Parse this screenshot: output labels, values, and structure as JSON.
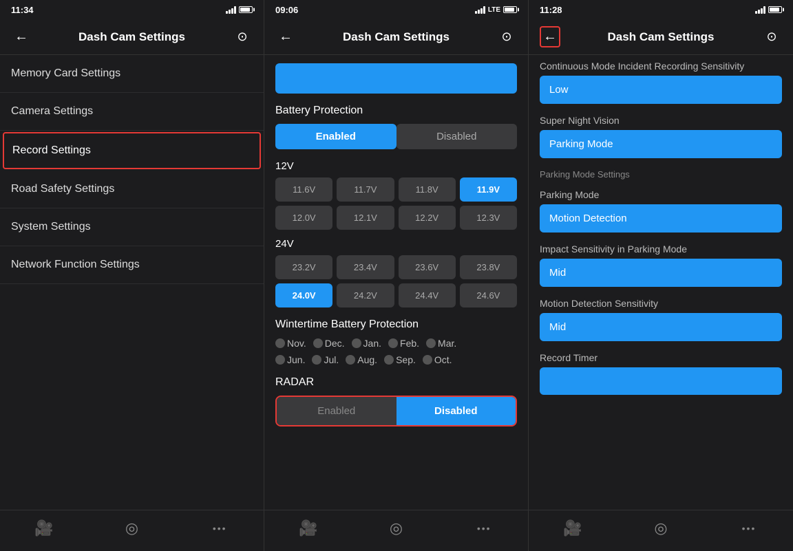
{
  "panels": [
    {
      "id": "left",
      "statusBar": {
        "time": "11:34",
        "signal": true,
        "battery": true
      },
      "header": {
        "backLabel": "←",
        "title": "Dash Cam Settings",
        "iconLabel": "⊙"
      },
      "menuItems": [
        {
          "id": "memory-card",
          "label": "Memory Card Settings",
          "active": false
        },
        {
          "id": "camera",
          "label": "Camera Settings",
          "active": false
        },
        {
          "id": "record",
          "label": "Record Settings",
          "active": true
        },
        {
          "id": "road-safety",
          "label": "Road Safety Settings",
          "active": false
        },
        {
          "id": "system",
          "label": "System Settings",
          "active": false
        },
        {
          "id": "network",
          "label": "Network Function Settings",
          "active": false
        }
      ],
      "tabBar": {
        "items": [
          {
            "id": "camera-tab",
            "icon": "🎥",
            "active": true
          },
          {
            "id": "wifi-tab",
            "icon": "◎",
            "active": false
          },
          {
            "id": "more-tab",
            "icon": "•••",
            "active": false
          }
        ]
      }
    },
    {
      "id": "middle",
      "statusBar": {
        "time": "09:06",
        "signal": true,
        "lte": true,
        "battery": true
      },
      "header": {
        "backLabel": "←",
        "title": "Dash Cam Settings",
        "iconLabel": "⊙"
      },
      "batteryProtection": {
        "label": "Battery Protection",
        "enabledLabel": "Enabled",
        "disabledLabel": "Disabled",
        "selected": "enabled"
      },
      "voltage12": {
        "label": "12V",
        "values": [
          {
            "val": "11.6V",
            "selected": false
          },
          {
            "val": "11.7V",
            "selected": false
          },
          {
            "val": "11.8V",
            "selected": false
          },
          {
            "val": "11.9V",
            "selected": true
          },
          {
            "val": "12.0V",
            "selected": false
          },
          {
            "val": "12.1V",
            "selected": false
          },
          {
            "val": "12.2V",
            "selected": false
          },
          {
            "val": "12.3V",
            "selected": false
          }
        ]
      },
      "voltage24": {
        "label": "24V",
        "values": [
          {
            "val": "23.2V",
            "selected": false
          },
          {
            "val": "23.4V",
            "selected": false
          },
          {
            "val": "23.6V",
            "selected": false
          },
          {
            "val": "23.8V",
            "selected": false
          },
          {
            "val": "24.0V",
            "selected": true
          },
          {
            "val": "24.2V",
            "selected": false
          },
          {
            "val": "24.4V",
            "selected": false
          },
          {
            "val": "24.6V",
            "selected": false
          }
        ]
      },
      "wintertimeBatteryProtection": {
        "label": "Wintertime Battery Protection",
        "months1": [
          "Nov.",
          "Dec.",
          "Jan.",
          "Feb.",
          "Mar."
        ],
        "months2": [
          "Jun.",
          "Jul.",
          "Aug.",
          "Sep.",
          "Oct."
        ]
      },
      "radar": {
        "label": "RADAR",
        "enabledLabel": "Enabled",
        "disabledLabel": "Disabled",
        "selected": "disabled"
      },
      "tabBar": {
        "items": [
          {
            "id": "camera-tab",
            "icon": "🎥",
            "active": true
          },
          {
            "id": "wifi-tab",
            "icon": "◎",
            "active": false
          },
          {
            "id": "more-tab",
            "icon": "•••",
            "active": false
          }
        ]
      }
    },
    {
      "id": "right",
      "statusBar": {
        "time": "11:28",
        "signal": true,
        "battery": true
      },
      "header": {
        "backLabel": "←",
        "backBoxed": true,
        "title": "Dash Cam Settings",
        "iconLabel": "⊙"
      },
      "settings": [
        {
          "id": "continuous-mode",
          "label": "Continuous Mode Incident Recording Sensitivity",
          "value": "Low"
        },
        {
          "id": "super-night-vision",
          "label": "Super Night Vision",
          "value": "Parking Mode"
        }
      ],
      "parkingModeSection": {
        "headerLabel": "Parking Mode Settings",
        "settings": [
          {
            "id": "parking-mode",
            "label": "Parking Mode",
            "value": "Motion Detection"
          },
          {
            "id": "impact-sensitivity",
            "label": "Impact Sensitivity in Parking Mode",
            "value": "Mid"
          },
          {
            "id": "motion-detection-sensitivity",
            "label": "Motion Detection Sensitivity",
            "value": "Mid"
          }
        ]
      },
      "recordTimer": {
        "label": "Record Timer",
        "value": ""
      },
      "tabBar": {
        "items": [
          {
            "id": "camera-tab",
            "icon": "🎥",
            "active": true
          },
          {
            "id": "wifi-tab",
            "icon": "◎",
            "active": false
          },
          {
            "id": "more-tab",
            "icon": "•••",
            "active": false
          }
        ]
      }
    }
  ]
}
